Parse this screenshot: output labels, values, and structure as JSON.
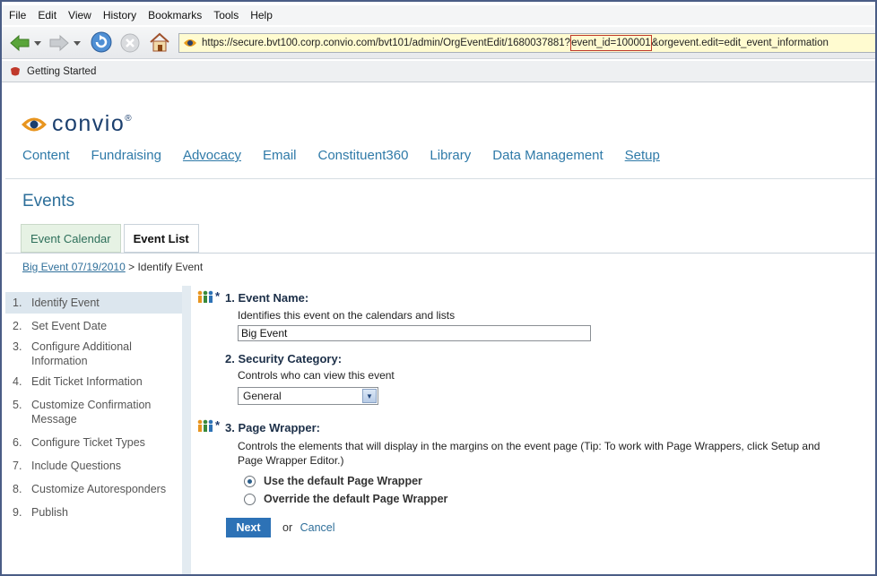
{
  "browser": {
    "menu": [
      "File",
      "Edit",
      "View",
      "History",
      "Bookmarks",
      "Tools",
      "Help"
    ],
    "url_before": "https://secure.bvt100.corp.convio.com/bvt101/admin/OrgEventEdit/1680037881?",
    "url_highlight": "event_id=100001",
    "url_after": "&orgevent.edit=edit_event_information",
    "bookmark": "Getting Started"
  },
  "brand": {
    "name": "convio",
    "mark": "®"
  },
  "topnav": [
    "Content",
    "Fundraising",
    "Advocacy",
    "Email",
    "Constituent360",
    "Library",
    "Data Management",
    "Setup"
  ],
  "section_title": "Events",
  "tabs": [
    "Event Calendar",
    "Event List"
  ],
  "breadcrumb": {
    "link": "Big Event 07/19/2010",
    "separator": ">",
    "current": "Identify Event"
  },
  "steps": [
    {
      "num": "1.",
      "label": "Identify Event"
    },
    {
      "num": "2.",
      "label": "Set Event Date"
    },
    {
      "num": "3.",
      "label": "Configure Additional Information"
    },
    {
      "num": "4.",
      "label": "Edit Ticket Information"
    },
    {
      "num": "5.",
      "label": "Customize Confirmation Message"
    },
    {
      "num": "6.",
      "label": "Configure Ticket Types"
    },
    {
      "num": "7.",
      "label": "Include Questions"
    },
    {
      "num": "8.",
      "label": "Customize Autoresponders"
    },
    {
      "num": "9.",
      "label": "Publish"
    }
  ],
  "form": {
    "required_mark": "*",
    "q1": {
      "label": "1. Event Name:",
      "hint": "Identifies this event on the calendars and lists",
      "value": "Big Event"
    },
    "q2": {
      "label": "2. Security Category:",
      "hint": "Controls who can view this event",
      "value": "General"
    },
    "q3": {
      "label": "3. Page Wrapper:",
      "hint_line1": "Controls the elements that will display in the margins on the event page (Tip: To work with Page Wrappers, click Setup and",
      "hint_line2": "Page Wrapper Editor.)",
      "option1": "Use the default Page Wrapper",
      "option2": "Override the default Page Wrapper"
    },
    "next": "Next",
    "or": "or",
    "cancel": "Cancel"
  }
}
